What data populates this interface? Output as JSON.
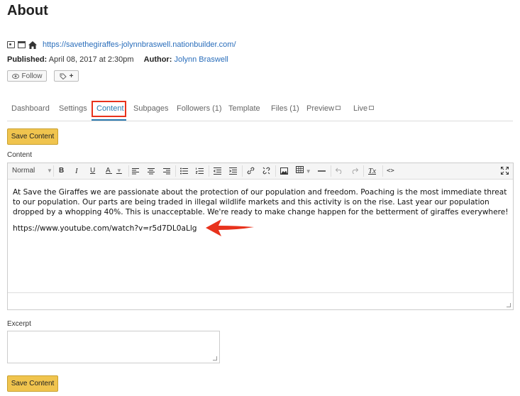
{
  "page": {
    "title": "About"
  },
  "header": {
    "url": "https://savethegiraffes-jolynnbraswell.nationbuilder.com/",
    "published_label": "Published:",
    "published_value": "April 08, 2017 at 2:30pm",
    "author_label": "Author:",
    "author_value": "Jolynn Braswell",
    "follow_label": "Follow",
    "tag_plus": "+"
  },
  "tabs": [
    {
      "label": "Dashboard"
    },
    {
      "label": "Settings"
    },
    {
      "label": "Content"
    },
    {
      "label": "Subpages"
    },
    {
      "label": "Followers (1)"
    },
    {
      "label": "Template"
    },
    {
      "label": "Files (1)"
    },
    {
      "label": "Preview"
    },
    {
      "label": "Live"
    }
  ],
  "active_tab": "Content",
  "actions": {
    "save_label": "Save Content"
  },
  "content": {
    "label": "Content",
    "toolbar": {
      "style_select": "Normal",
      "bold": "B",
      "italic": "I",
      "underline": "U",
      "font_color": "A",
      "clear_format": "Tx",
      "source": "<>"
    },
    "paragraphs": [
      "At Save the Giraffes we are passionate about the protection of our population and freedom. Poaching is the most immediate threat to our population. Our parts are being traded in illegal wildlife markets and this activity is on the rise. Last year our population dropped by a whopping 40%. This is unacceptable. We're ready to make change happen for the betterment of giraffes everywhere!",
      "https://www.youtube.com/watch?v=r5d7DL0aLlg"
    ]
  },
  "excerpt": {
    "label": "Excerpt",
    "value": ""
  },
  "colors": {
    "accent": "#2a7ab0",
    "highlight": "#e8321c",
    "save_button": "#f0c44e",
    "link": "#2a6ebb"
  },
  "icons": [
    "page-icon",
    "window-icon",
    "home-icon",
    "eye-icon",
    "tag-icon",
    "external-link-icon",
    "fullscreen-icon",
    "arrow-annotation-icon"
  ]
}
